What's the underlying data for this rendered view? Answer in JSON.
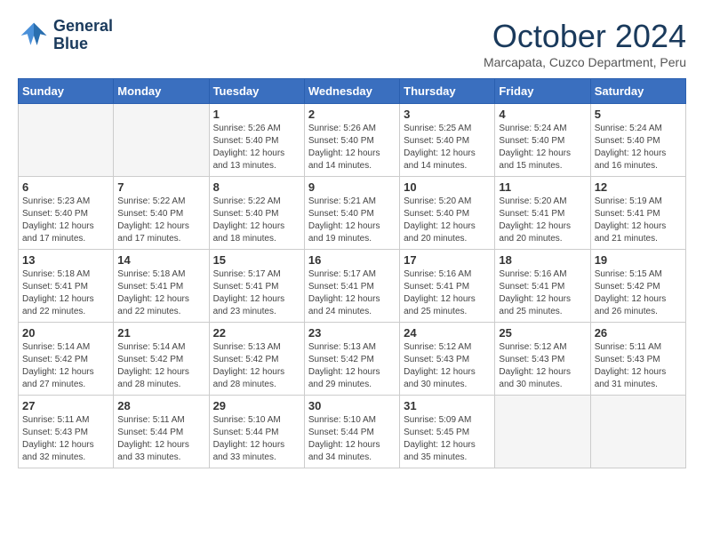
{
  "header": {
    "logo_line1": "General",
    "logo_line2": "Blue",
    "month_title": "October 2024",
    "subtitle": "Marcapata, Cuzco Department, Peru"
  },
  "weekdays": [
    "Sunday",
    "Monday",
    "Tuesday",
    "Wednesday",
    "Thursday",
    "Friday",
    "Saturday"
  ],
  "weeks": [
    [
      {
        "day": "",
        "empty": true
      },
      {
        "day": "",
        "empty": true
      },
      {
        "day": "1",
        "sunrise": "5:26 AM",
        "sunset": "5:40 PM",
        "daylight": "12 hours and 13 minutes."
      },
      {
        "day": "2",
        "sunrise": "5:26 AM",
        "sunset": "5:40 PM",
        "daylight": "12 hours and 14 minutes."
      },
      {
        "day": "3",
        "sunrise": "5:25 AM",
        "sunset": "5:40 PM",
        "daylight": "12 hours and 14 minutes."
      },
      {
        "day": "4",
        "sunrise": "5:24 AM",
        "sunset": "5:40 PM",
        "daylight": "12 hours and 15 minutes."
      },
      {
        "day": "5",
        "sunrise": "5:24 AM",
        "sunset": "5:40 PM",
        "daylight": "12 hours and 16 minutes."
      }
    ],
    [
      {
        "day": "6",
        "sunrise": "5:23 AM",
        "sunset": "5:40 PM",
        "daylight": "12 hours and 17 minutes."
      },
      {
        "day": "7",
        "sunrise": "5:22 AM",
        "sunset": "5:40 PM",
        "daylight": "12 hours and 17 minutes."
      },
      {
        "day": "8",
        "sunrise": "5:22 AM",
        "sunset": "5:40 PM",
        "daylight": "12 hours and 18 minutes."
      },
      {
        "day": "9",
        "sunrise": "5:21 AM",
        "sunset": "5:40 PM",
        "daylight": "12 hours and 19 minutes."
      },
      {
        "day": "10",
        "sunrise": "5:20 AM",
        "sunset": "5:40 PM",
        "daylight": "12 hours and 20 minutes."
      },
      {
        "day": "11",
        "sunrise": "5:20 AM",
        "sunset": "5:41 PM",
        "daylight": "12 hours and 20 minutes."
      },
      {
        "day": "12",
        "sunrise": "5:19 AM",
        "sunset": "5:41 PM",
        "daylight": "12 hours and 21 minutes."
      }
    ],
    [
      {
        "day": "13",
        "sunrise": "5:18 AM",
        "sunset": "5:41 PM",
        "daylight": "12 hours and 22 minutes."
      },
      {
        "day": "14",
        "sunrise": "5:18 AM",
        "sunset": "5:41 PM",
        "daylight": "12 hours and 22 minutes."
      },
      {
        "day": "15",
        "sunrise": "5:17 AM",
        "sunset": "5:41 PM",
        "daylight": "12 hours and 23 minutes."
      },
      {
        "day": "16",
        "sunrise": "5:17 AM",
        "sunset": "5:41 PM",
        "daylight": "12 hours and 24 minutes."
      },
      {
        "day": "17",
        "sunrise": "5:16 AM",
        "sunset": "5:41 PM",
        "daylight": "12 hours and 25 minutes."
      },
      {
        "day": "18",
        "sunrise": "5:16 AM",
        "sunset": "5:41 PM",
        "daylight": "12 hours and 25 minutes."
      },
      {
        "day": "19",
        "sunrise": "5:15 AM",
        "sunset": "5:42 PM",
        "daylight": "12 hours and 26 minutes."
      }
    ],
    [
      {
        "day": "20",
        "sunrise": "5:14 AM",
        "sunset": "5:42 PM",
        "daylight": "12 hours and 27 minutes."
      },
      {
        "day": "21",
        "sunrise": "5:14 AM",
        "sunset": "5:42 PM",
        "daylight": "12 hours and 28 minutes."
      },
      {
        "day": "22",
        "sunrise": "5:13 AM",
        "sunset": "5:42 PM",
        "daylight": "12 hours and 28 minutes."
      },
      {
        "day": "23",
        "sunrise": "5:13 AM",
        "sunset": "5:42 PM",
        "daylight": "12 hours and 29 minutes."
      },
      {
        "day": "24",
        "sunrise": "5:12 AM",
        "sunset": "5:43 PM",
        "daylight": "12 hours and 30 minutes."
      },
      {
        "day": "25",
        "sunrise": "5:12 AM",
        "sunset": "5:43 PM",
        "daylight": "12 hours and 30 minutes."
      },
      {
        "day": "26",
        "sunrise": "5:11 AM",
        "sunset": "5:43 PM",
        "daylight": "12 hours and 31 minutes."
      }
    ],
    [
      {
        "day": "27",
        "sunrise": "5:11 AM",
        "sunset": "5:43 PM",
        "daylight": "12 hours and 32 minutes."
      },
      {
        "day": "28",
        "sunrise": "5:11 AM",
        "sunset": "5:44 PM",
        "daylight": "12 hours and 33 minutes."
      },
      {
        "day": "29",
        "sunrise": "5:10 AM",
        "sunset": "5:44 PM",
        "daylight": "12 hours and 33 minutes."
      },
      {
        "day": "30",
        "sunrise": "5:10 AM",
        "sunset": "5:44 PM",
        "daylight": "12 hours and 34 minutes."
      },
      {
        "day": "31",
        "sunrise": "5:09 AM",
        "sunset": "5:45 PM",
        "daylight": "12 hours and 35 minutes."
      },
      {
        "day": "",
        "empty": true
      },
      {
        "day": "",
        "empty": true
      }
    ]
  ]
}
